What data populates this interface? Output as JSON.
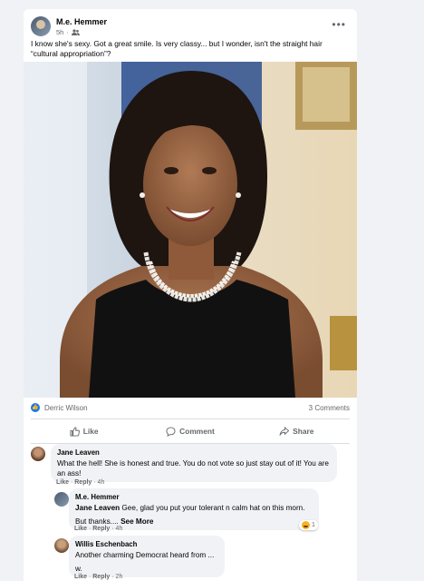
{
  "post": {
    "author": "M.e. Hemmer",
    "time": "5h",
    "audience_icon": "friends-icon",
    "text": "I know she's sexy. Got a great smile. Is very classy... but I wonder, isn't the straight hair “cultural appropriation”?"
  },
  "reactions": {
    "reactor": "Derric Wilson",
    "comments_count": "3 Comments"
  },
  "actions": {
    "like": "Like",
    "comment": "Comment",
    "share": "Share"
  },
  "comments": [
    {
      "name": "Jane Leaven",
      "text": "What the hell! She is honest and true. You do not vote so just stay out of it! You are an ass!",
      "like": "Like",
      "reply": "Reply",
      "time": "4h"
    },
    {
      "name": "M.e. Hemmer",
      "tag": "Jane Leaven",
      "text": " Gee, glad you put your tolerant n calm hat on this morn.",
      "text2": "But thanks.... ",
      "see_more": "See More",
      "like": "Like",
      "reply": "Reply",
      "time": "4h",
      "reaction_count": "1"
    },
    {
      "name": "Willis Eschenbach",
      "text": "Another charming Democrat heard from ...",
      "text2": "w.",
      "like": "Like",
      "reply": "Reply",
      "time": "2h"
    }
  ],
  "colors": {
    "accent": "#1877f2",
    "secondary_text": "#65676b",
    "bubble": "#f0f2f5"
  }
}
